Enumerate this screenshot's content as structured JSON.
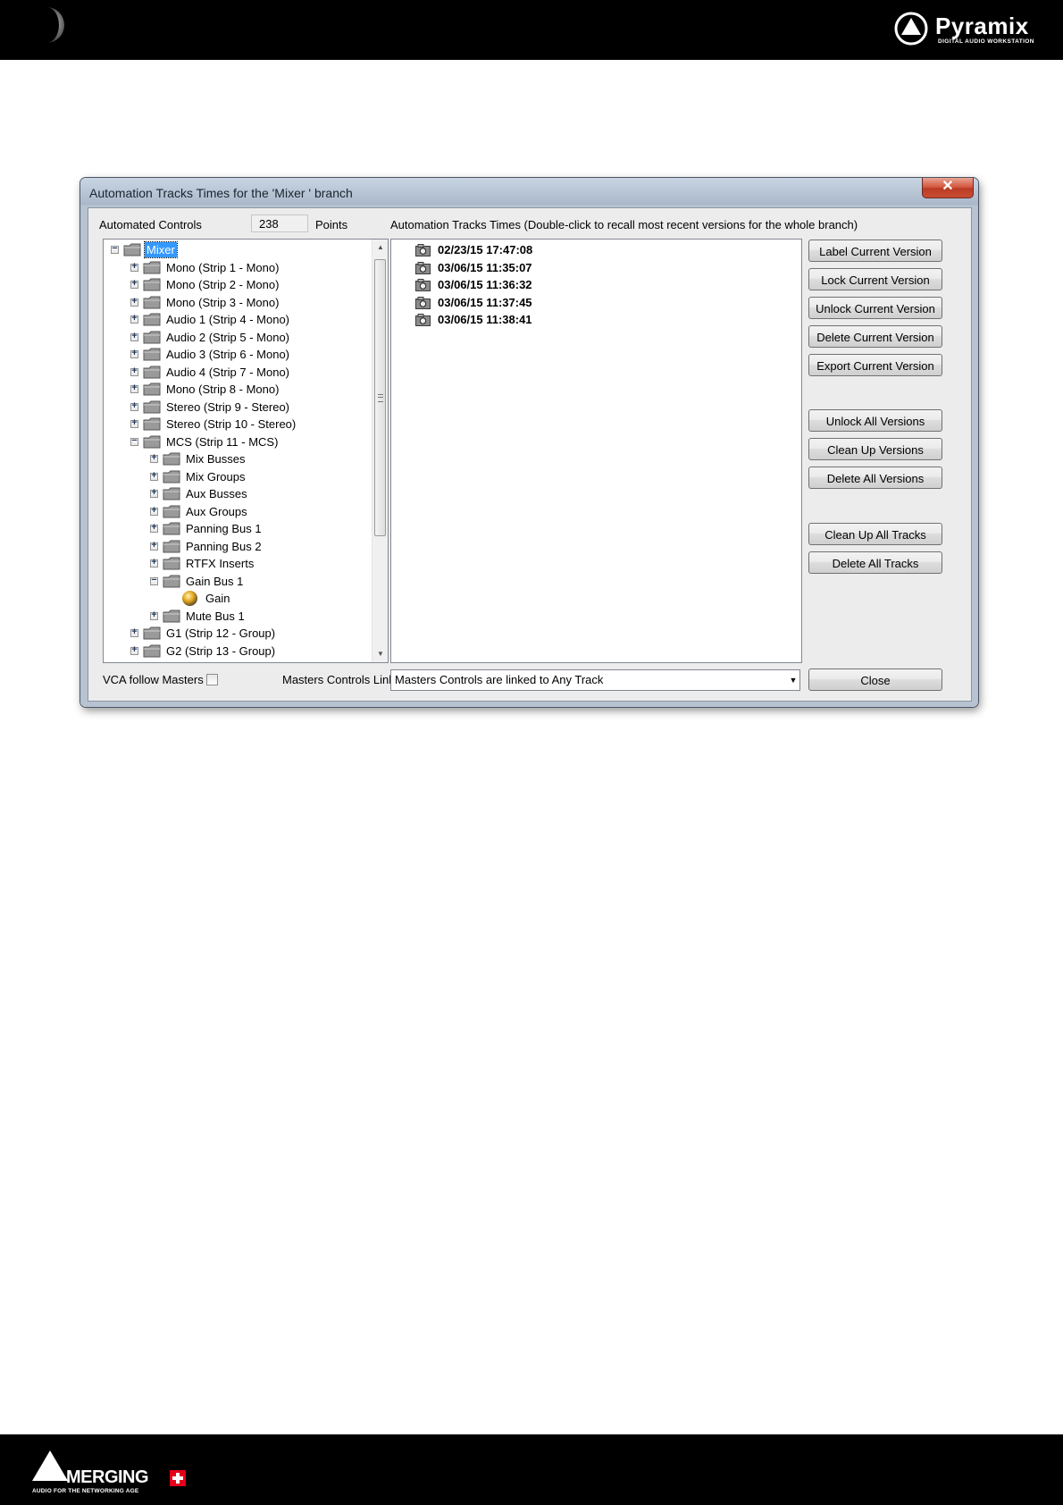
{
  "page": {
    "brand_name": "Pyramix",
    "brand_tagline": "DIGITAL AUDIO WORKSTATION",
    "footer_name": "MERGING",
    "footer_tagline": "AUDIO FOR THE NETWORKING AGE"
  },
  "dialog": {
    "title": "Automation Tracks Times for the 'Mixer ' branch",
    "close_glyph": "✕",
    "automated_controls_label": "Automated Controls",
    "points_value": "238",
    "points_label": "Points",
    "versions_header": "Automation Tracks Times (Double-click to recall most recent versions for the whole branch)",
    "tree": [
      {
        "label": "Mixer",
        "level": 0,
        "expander": "−",
        "selected": true,
        "type": "folder"
      },
      {
        "label": "Mono (Strip 1 - Mono)",
        "level": 1,
        "expander": "+",
        "type": "folder"
      },
      {
        "label": "Mono (Strip 2 - Mono)",
        "level": 1,
        "expander": "+",
        "type": "folder"
      },
      {
        "label": "Mono (Strip 3 - Mono)",
        "level": 1,
        "expander": "+",
        "type": "folder"
      },
      {
        "label": "Audio 1 (Strip 4 - Mono)",
        "level": 1,
        "expander": "+",
        "type": "folder"
      },
      {
        "label": "Audio 2 (Strip 5 - Mono)",
        "level": 1,
        "expander": "+",
        "type": "folder"
      },
      {
        "label": "Audio 3 (Strip 6 - Mono)",
        "level": 1,
        "expander": "+",
        "type": "folder"
      },
      {
        "label": "Audio 4 (Strip 7 - Mono)",
        "level": 1,
        "expander": "+",
        "type": "folder"
      },
      {
        "label": "Mono (Strip 8 - Mono)",
        "level": 1,
        "expander": "+",
        "type": "folder"
      },
      {
        "label": "Stereo (Strip 9 - Stereo)",
        "level": 1,
        "expander": "+",
        "type": "folder"
      },
      {
        "label": "Stereo (Strip 10 - Stereo)",
        "level": 1,
        "expander": "+",
        "type": "folder"
      },
      {
        "label": "MCS (Strip 11 - MCS)",
        "level": 1,
        "expander": "−",
        "type": "folder"
      },
      {
        "label": "Mix Busses",
        "level": 2,
        "expander": "+",
        "type": "folder"
      },
      {
        "label": "Mix Groups",
        "level": 2,
        "expander": "+",
        "type": "folder"
      },
      {
        "label": "Aux Busses",
        "level": 2,
        "expander": "+",
        "type": "folder"
      },
      {
        "label": "Aux Groups",
        "level": 2,
        "expander": "+",
        "type": "folder"
      },
      {
        "label": "Panning Bus 1",
        "level": 2,
        "expander": "+",
        "type": "folder"
      },
      {
        "label": "Panning Bus 2",
        "level": 2,
        "expander": "+",
        "type": "folder"
      },
      {
        "label": "RTFX Inserts",
        "level": 2,
        "expander": "+",
        "type": "folder"
      },
      {
        "label": "Gain Bus 1",
        "level": 2,
        "expander": "−",
        "type": "folder"
      },
      {
        "label": "Gain",
        "level": 3,
        "expander": "",
        "type": "control"
      },
      {
        "label": "Mute Bus 1",
        "level": 2,
        "expander": "+",
        "type": "folder"
      },
      {
        "label": "G1 (Strip 12 - Group)",
        "level": 1,
        "expander": "+",
        "type": "folder"
      },
      {
        "label": "G2 (Strip 13 - Group)",
        "level": 1,
        "expander": "+",
        "type": "folder"
      }
    ],
    "versions": [
      "02/23/15 17:47:08",
      "03/06/15 11:35:07",
      "03/06/15 11:36:32",
      "03/06/15 11:37:45",
      "03/06/15 11:38:41"
    ],
    "buttons": {
      "label_current": "Label Current Version",
      "lock_current": "Lock Current Version",
      "unlock_current": "Unlock Current Version",
      "delete_current": "Delete Current Version",
      "export_current": "Export Current Version",
      "unlock_all": "Unlock All Versions",
      "clean_versions": "Clean Up Versions",
      "delete_all_versions": "Delete All Versions",
      "clean_tracks": "Clean Up All Tracks",
      "delete_all_tracks": "Delete All Tracks",
      "close": "Close"
    },
    "vca_label": "VCA follow Masters",
    "vca_checked": false,
    "masters_link_label": "Masters Controls Link",
    "masters_link_value": "Masters Controls are linked to Any Track"
  },
  "colors": {
    "selection": "#3399ff",
    "header_bar": "#000000",
    "footer_accent": "#e3001b"
  }
}
